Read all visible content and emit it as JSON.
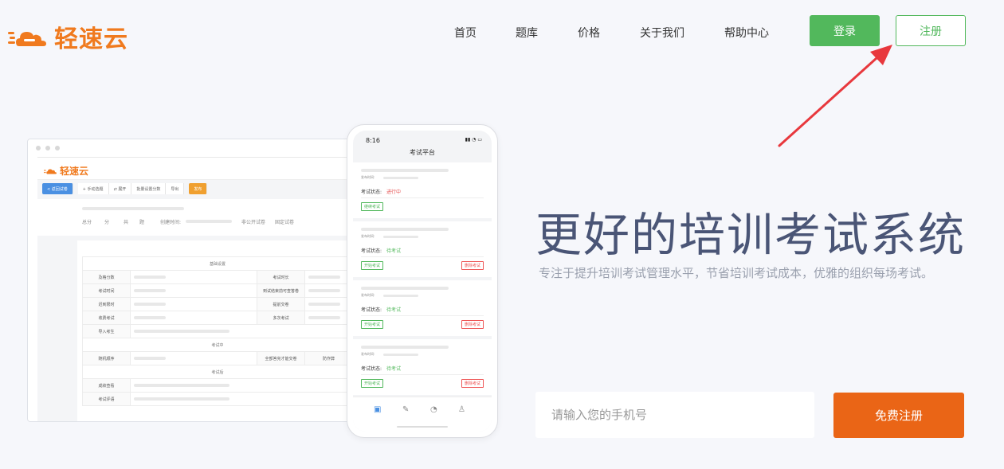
{
  "header": {
    "logo_text": "轻速云",
    "nav": [
      "首页",
      "题库",
      "价格",
      "关于我们",
      "帮助中心"
    ],
    "login_label": "登录",
    "register_label": "注册"
  },
  "hero": {
    "title": "更好的培训考试系统",
    "subtitle": "专注于提升培训考试管理水平，节省培训考试成本，优雅的组织每场考试。",
    "phone_placeholder": "请输入您的手机号",
    "cta_label": "免费注册"
  },
  "desktop_mock": {
    "logo_text": "轻速云",
    "toolbar": [
      "< 返回试卷",
      "+ 手动选题",
      "⇄ 展开",
      "批量设置分数",
      "导出",
      "发布"
    ],
    "info": [
      "总分",
      "分",
      "共",
      "题",
      "创建时间:",
      "非公开试卷",
      "固定试卷"
    ],
    "sections": [
      "基础设置",
      "考试中",
      "考试后"
    ],
    "rows": [
      "及格分数",
      "考试时长",
      "考试时间",
      "到试结束前可查答卷",
      "迟到限时",
      "提前交卷",
      "收费考试",
      "多次考试",
      "导入考生",
      "随机顺序",
      "全部答完才能交卷",
      "防作弊",
      "成绩查看",
      "考试评语"
    ]
  },
  "phone_mock": {
    "time": "8:16",
    "title": "考试平台",
    "cards": [
      {
        "published": "发布时间:",
        "status_label": "考试状态:",
        "status": "进行中",
        "status_color": "#e55353",
        "primary": "继续考试",
        "secondary": ""
      },
      {
        "published": "发布时间:",
        "status_label": "考试状态:",
        "status": "待考试",
        "status_color": "#52b85c",
        "primary": "开始考试",
        "secondary": "删除考试"
      },
      {
        "published": "发布时间:",
        "status_label": "考试状态:",
        "status": "待考试",
        "status_color": "#52b85c",
        "primary": "开始考试",
        "secondary": "删除考试"
      },
      {
        "published": "发布时间:",
        "status_label": "考试状态:",
        "status": "待考试",
        "status_color": "#52b85c",
        "primary": "开始考试",
        "secondary": "删除考试"
      }
    ],
    "tabs": [
      "exam-icon",
      "edit-icon",
      "check-icon",
      "user-icon"
    ]
  },
  "colors": {
    "brand": "#f07a1e",
    "green": "#52b85c",
    "cta": "#ea6516",
    "title": "#4a5576",
    "arrow": "#e8383d"
  }
}
